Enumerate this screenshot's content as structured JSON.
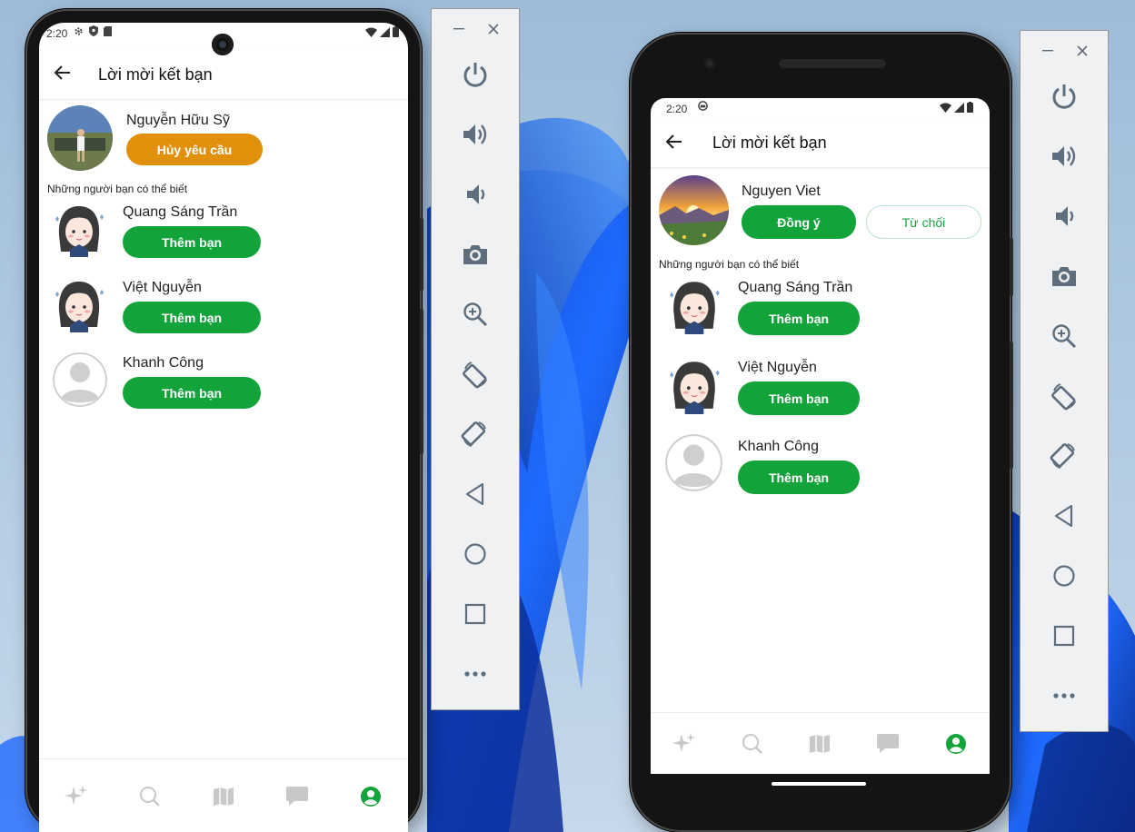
{
  "devices": [
    {
      "status": {
        "time": "2:20"
      },
      "header": {
        "title": "Lời mời kết bạn"
      },
      "request": {
        "name": "Nguyễn Hữu Sỹ",
        "cancel_label": "Hủy yêu cầu"
      },
      "suggestions_label": "Những người bạn có thể biết",
      "suggestions": [
        {
          "name": "Quang Sáng Trần",
          "add_label": "Thêm bạn"
        },
        {
          "name": "Việt Nguyễn",
          "add_label": "Thêm bạn"
        },
        {
          "name": "Khanh Công",
          "add_label": "Thêm bạn"
        }
      ],
      "nav": [
        "sparkle-icon",
        "search-icon",
        "map-icon",
        "chat-icon",
        "profile-icon"
      ],
      "nav_active": "profile-icon"
    },
    {
      "status": {
        "time": "2:20"
      },
      "header": {
        "title": "Lời mời kết bạn"
      },
      "request": {
        "name": "Nguyen Viet",
        "accept_label": "Đồng ý",
        "decline_label": "Từ chối"
      },
      "suggestions_label": "Những người bạn có thể biết",
      "suggestions": [
        {
          "name": "Quang Sáng Trần",
          "add_label": "Thêm bạn"
        },
        {
          "name": "Việt Nguyễn",
          "add_label": "Thêm bạn"
        },
        {
          "name": "Khanh Công",
          "add_label": "Thêm bạn"
        }
      ],
      "nav": [
        "sparkle-icon",
        "search-icon",
        "map-icon",
        "chat-icon",
        "profile-icon"
      ],
      "nav_active": "profile-icon"
    }
  ],
  "emulator_toolbar": {
    "window_controls": [
      "minimize-icon",
      "close-icon"
    ],
    "buttons": [
      "power-icon",
      "volume-up-icon",
      "volume-down-icon",
      "camera-icon",
      "zoom-icon",
      "rotate-left-icon",
      "rotate-right-icon",
      "back-icon",
      "home-icon",
      "overview-icon",
      "more-icon"
    ]
  },
  "colors": {
    "accent_green": "#12a33b",
    "cancel_orange": "#e0900b",
    "nav_inactive": "#c8c8c8",
    "toolbar_icon": "#5f6e7d"
  }
}
